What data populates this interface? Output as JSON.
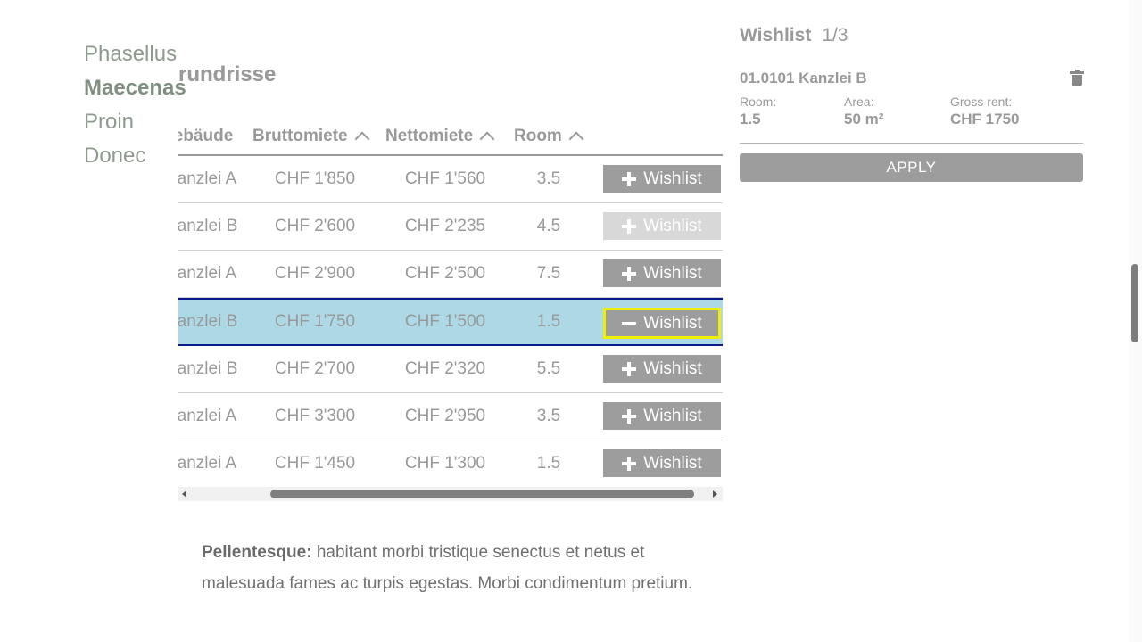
{
  "nav": {
    "items": [
      {
        "label": "Phasellus"
      },
      {
        "label": "Maecenas"
      },
      {
        "label": "Proin"
      },
      {
        "label": "Donec"
      }
    ],
    "active": "Maecenas"
  },
  "section": {
    "title": "d Grundrisse"
  },
  "table": {
    "headers": {
      "gebaeude": "Gebäude",
      "brutto": "Bruttomiete",
      "netto": "Nettomiete",
      "room": "Room"
    },
    "rows": [
      {
        "gebaeude": "Kanzlei A",
        "brutto": "CHF 1'850",
        "netto": "CHF 1'560",
        "room": "3.5",
        "wishlist": "Wishlist",
        "state": "add"
      },
      {
        "gebaeude": "Kanzlei B",
        "brutto": "CHF 2'600",
        "netto": "CHF 2'235",
        "room": "4.5",
        "wishlist": "Wishlist",
        "state": "disabled"
      },
      {
        "gebaeude": "Kanzlei A",
        "brutto": "CHF 2'900",
        "netto": "CHF 2'500",
        "room": "7.5",
        "wishlist": "Wishlist",
        "state": "add"
      },
      {
        "gebaeude": "Kanzlei B",
        "brutto": "CHF 1'750",
        "netto": "CHF 1'500",
        "room": "1.5",
        "wishlist": "Wishlist",
        "state": "remove"
      },
      {
        "gebaeude": "Kanzlei B",
        "brutto": "CHF 2'700",
        "netto": "CHF 2'320",
        "room": "5.5",
        "wishlist": "Wishlist",
        "state": "add"
      },
      {
        "gebaeude": "Kanzlei A",
        "brutto": "CHF 3'300",
        "netto": "CHF 2'950",
        "room": "3.5",
        "wishlist": "Wishlist",
        "state": "add"
      },
      {
        "gebaeude": "Kanzlei A",
        "brutto": "CHF 1'450",
        "netto": "CHF 1'300",
        "room": "1.5",
        "wishlist": "Wishlist",
        "state": "add"
      }
    ]
  },
  "paragraph": {
    "bold": "Pellentesque:",
    "text": " habitant morbi tristique senectus et netus et malesuada fames ac turpis egestas. Morbi condimentum pretium."
  },
  "wishlist": {
    "title": "Wishlist",
    "count": "1/3",
    "item": {
      "title": "01.0101 Kanzlei B",
      "room_label": "Room:",
      "room_value": "1.5",
      "area_label": "Area:",
      "area_value": "50 m²",
      "rent_label": "Gross rent:",
      "rent_value": "CHF 1750"
    },
    "apply_label": "APPLY"
  },
  "colors": {
    "button_gray": "#9d9d9d",
    "selected_row": "#add8e6",
    "selected_border": "#0a1a8c",
    "focus_outline": "#f2ee00"
  }
}
